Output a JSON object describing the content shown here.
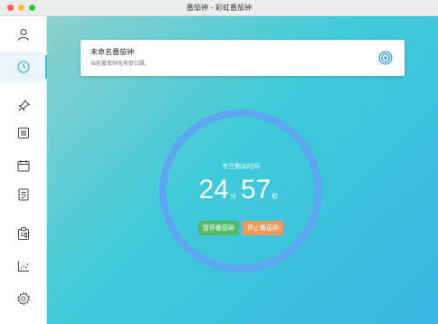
{
  "window": {
    "title": "番茄钟 - 彩虹番茄钟"
  },
  "sidebar": {
    "items": [
      {
        "id": "profile",
        "icon": "person-icon"
      },
      {
        "id": "timer",
        "icon": "clock-icon",
        "active": true
      },
      {
        "id": "pin",
        "icon": "pin-icon"
      },
      {
        "id": "list",
        "icon": "list-icon"
      },
      {
        "id": "calendar",
        "icon": "calendar-icon"
      },
      {
        "id": "notes",
        "icon": "notes-icon"
      },
      {
        "id": "clipboard",
        "icon": "clipboard-icon"
      },
      {
        "id": "stats",
        "icon": "chart-icon"
      },
      {
        "id": "settings",
        "icon": "gear-icon"
      }
    ]
  },
  "task": {
    "name": "未命名番茄钟",
    "subtitle": "当前番茄钟无项目归属。",
    "icon": "target-icon"
  },
  "timer": {
    "label": "专注剩余时间",
    "minutes": "24",
    "minutes_unit": "分",
    "seconds": "57",
    "seconds_unit": "秒"
  },
  "actions": {
    "pause": "暂停番茄钟",
    "stop": "停止番茄钟"
  },
  "colors": {
    "accent": "#3bbfd6",
    "ring": "#5ca6f2",
    "pause_button": "#58b96a",
    "stop_button": "#ec9b5b"
  }
}
